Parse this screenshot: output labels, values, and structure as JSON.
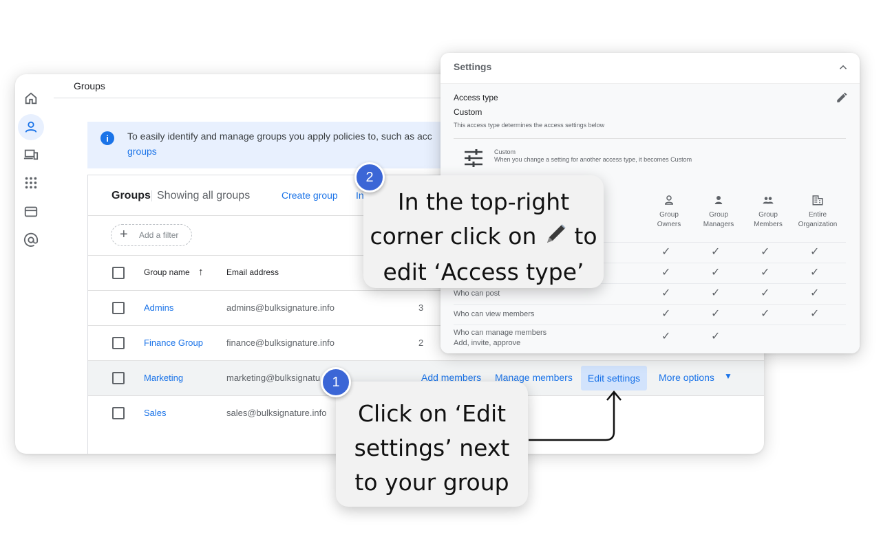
{
  "colors": {
    "accent": "#1a73e8",
    "badge": "#3b66d6",
    "highlight_row": "#f1f3f4",
    "banner": "#e8f0fe"
  },
  "sidebar": {
    "icons": [
      "home-icon",
      "user-icon",
      "devices-icon",
      "apps-grid-icon",
      "billing-card-icon",
      "at-sign-icon"
    ]
  },
  "header": {
    "title": "Groups"
  },
  "banner": {
    "text": "To easily identify and manage groups you apply policies to, such as acc",
    "link": "groups"
  },
  "card": {
    "title": "Groups",
    "subtitle": "Showing all groups",
    "create_group": "Create group",
    "invite": "In",
    "add_filter": "Add a filter",
    "columns": {
      "name": "Group name",
      "email": "Email address"
    }
  },
  "groups": [
    {
      "name": "Admins",
      "email": "admins@bulksignature.info",
      "count": "3"
    },
    {
      "name": "Finance Group",
      "email": "finance@bulksignature.info",
      "count": "2"
    },
    {
      "name": "Marketing",
      "email": "marketing@bulksignatu",
      "count": ""
    },
    {
      "name": "Sales",
      "email": "sales@bulksignature.info",
      "count": ""
    }
  ],
  "row_actions": {
    "add_members": "Add members",
    "manage_members": "Manage members",
    "edit_settings": "Edit settings",
    "more_options": "More options"
  },
  "settings": {
    "title": "Settings",
    "access_type_label": "Access type",
    "access_type_value": "Custom",
    "access_type_desc": "This access type determines the access settings below",
    "custom_title": "Custom",
    "custom_desc": "When you change a setting for another access type, it becomes Custom",
    "columns": [
      {
        "icon": "group-owner-icon",
        "label1": "Group",
        "label2": "Owners"
      },
      {
        "icon": "group-manager-icon",
        "label1": "Group",
        "label2": "Managers"
      },
      {
        "icon": "group-members-icon",
        "label1": "Group",
        "label2": "Members"
      },
      {
        "icon": "organization-icon",
        "label1": "Entire",
        "label2": "Organization"
      }
    ],
    "rows": [
      {
        "label": "",
        "label2": "",
        "checks": [
          true,
          true,
          true,
          true
        ]
      },
      {
        "label": "",
        "label2": "",
        "checks": [
          true,
          true,
          true,
          true
        ]
      },
      {
        "label": "Who can post",
        "label2": "",
        "checks": [
          true,
          true,
          true,
          true
        ]
      },
      {
        "label": "Who can view members",
        "label2": "",
        "checks": [
          true,
          true,
          true,
          true
        ]
      },
      {
        "label": "Who can manage members",
        "label2": "Add, invite, approve",
        "checks": [
          true,
          true,
          false,
          false
        ]
      }
    ]
  },
  "callouts": {
    "step1": {
      "badge": "1",
      "line1": "Click on ‘Edit",
      "line2": "settings’ next",
      "line3": "to your group"
    },
    "step2": {
      "badge": "2",
      "line1": "In the top-right",
      "line2a": "corner click on",
      "line2b": "to",
      "line3": "edit ‘Access type’"
    }
  }
}
